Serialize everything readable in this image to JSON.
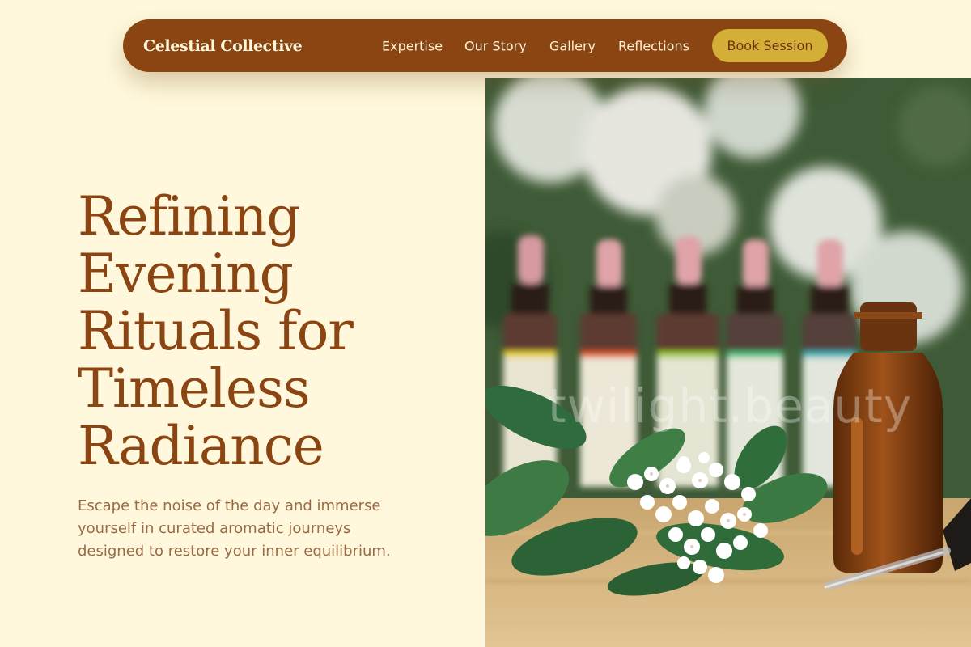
{
  "nav": {
    "brand": "Celestial Collective",
    "links": [
      "Expertise",
      "Our Story",
      "Gallery",
      "Reflections"
    ],
    "cta": "Book Session"
  },
  "hero": {
    "headline": "Refining Evening Rituals for Timeless Radiance",
    "subtitle": "Escape the noise of the day and immerse yourself in curated aromatic journeys designed to restore your inner equilibrium.",
    "image_watermark": "twilight.beauty"
  },
  "colors": {
    "background": "#fff8dc",
    "nav": "#8b4513",
    "accent_gold": "#d4af37",
    "headline": "#8b4513",
    "subtitle": "#9a6a45"
  }
}
